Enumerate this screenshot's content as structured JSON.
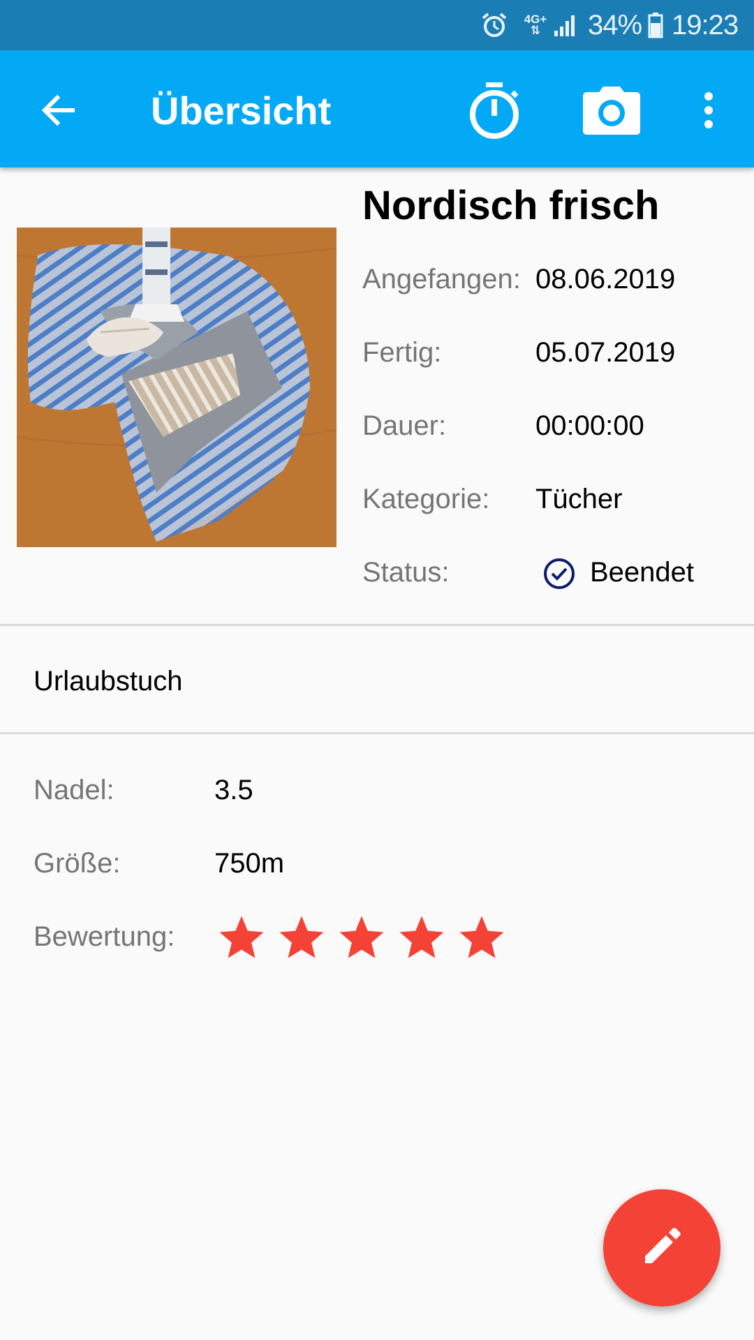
{
  "status_bar": {
    "network": "4G+",
    "battery_percent": "34%",
    "time": "19:23",
    "icons": [
      "alarm-icon",
      "network-icon",
      "signal-icon",
      "battery-icon"
    ]
  },
  "app_bar": {
    "title": "Übersicht",
    "color": "#03a9f4",
    "icons": [
      "back-arrow-icon",
      "timer-icon",
      "camera-icon",
      "more-vert-icon"
    ]
  },
  "project": {
    "title": "Nordisch frisch",
    "photo": "knitted-shawl-photo",
    "info": [
      {
        "label": "Angefangen:",
        "value": "08.06.2019"
      },
      {
        "label": "Fertig:",
        "value": "05.07.2019"
      },
      {
        "label": "Dauer:",
        "value": "00:00:00"
      },
      {
        "label": "Kategorie:",
        "value": "Tücher"
      }
    ],
    "status": {
      "label": "Status:",
      "value": "Beendet",
      "icon": "check-circle-icon",
      "icon_color": "#0d1b6b"
    },
    "description": "Urlaubstuch"
  },
  "details": {
    "needle": {
      "label": "Nadel:",
      "value": "3.5"
    },
    "size": {
      "label": "Größe:",
      "value": "750m"
    },
    "rating": {
      "label": "Bewertung:",
      "value": 5,
      "max": 5,
      "star_color": "#f44336"
    }
  },
  "fab": {
    "icon": "edit-pencil-icon",
    "color": "#f44336"
  }
}
